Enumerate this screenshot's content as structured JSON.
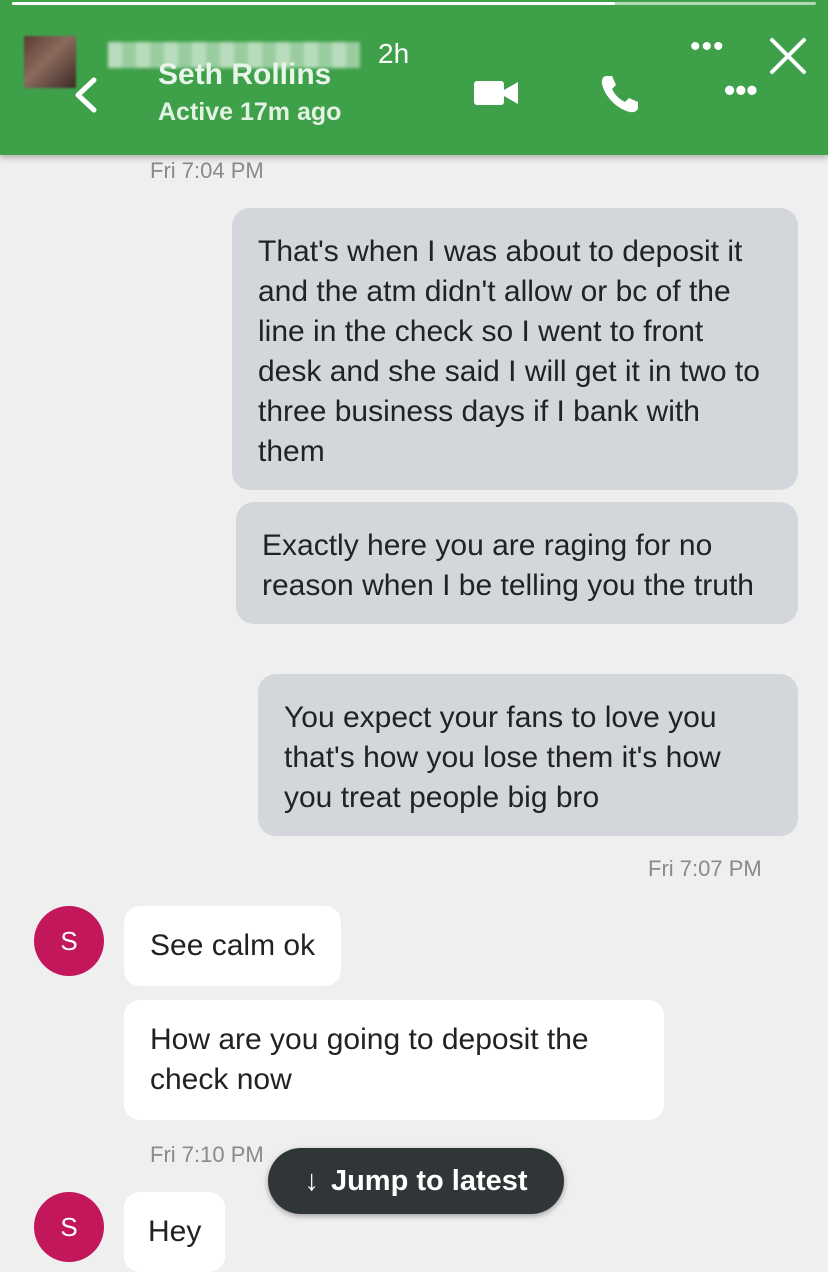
{
  "story": {
    "time": "2h",
    "more_label": "•••",
    "progress": 0.75
  },
  "header": {
    "contact_name": "Seth Rollins",
    "status": "Active 17m ago",
    "more_label": "•••"
  },
  "messages": {
    "ts1": "Fri 7:04 PM",
    "out1": "That's when I was about to deposit it and the atm didn't allow or bc of the line in the check so I went to front desk and she said  I will get it in two to three business  days if I bank  with them",
    "out2": "Exactly  here you are raging  for no reason  when I be telling you  the truth",
    "out3": "You expect your fans to love you that's how you lose them it's how you treat people big bro",
    "ts2": "Fri 7:07 PM",
    "in_avatar": "S",
    "in1": "See calm ok",
    "in2": "How are you going to deposit the check now",
    "ts3": "Fri 7:10 PM",
    "in3": "Hey"
  },
  "jump": {
    "arrow": "↓",
    "label": "Jump to latest"
  },
  "colors": {
    "header": "#3fa04a",
    "avatar": "#c2185b",
    "outgoing_bubble": "#d3d7dc",
    "incoming_bubble": "#ffffff"
  }
}
